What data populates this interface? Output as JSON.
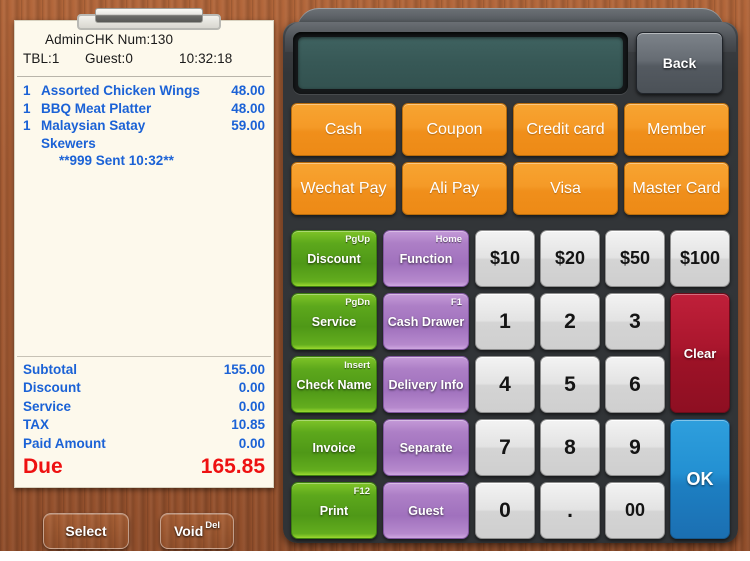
{
  "receipt": {
    "header": {
      "user": "Admin",
      "check_label": "CHK Num:130",
      "table_label": "TBL:1",
      "guest_label": "Guest:0",
      "time": "10:32:18"
    },
    "items": [
      {
        "qty": "1",
        "name": "Assorted Chicken Wings",
        "amount": "48.00"
      },
      {
        "qty": "1",
        "name": "BBQ Meat Platter",
        "amount": "48.00"
      },
      {
        "qty": "1",
        "name": "Malaysian Satay Skewers",
        "amount": "59.00"
      }
    ],
    "note": "**999 Sent 10:32**",
    "totals": [
      {
        "label": "Subtotal",
        "value": "155.00"
      },
      {
        "label": "Discount",
        "value": "0.00"
      },
      {
        "label": "Service",
        "value": "0.00"
      },
      {
        "label": "TAX",
        "value": "10.85"
      },
      {
        "label": "Paid Amount",
        "value": "0.00"
      }
    ],
    "due": {
      "label": "Due",
      "value": "165.85"
    }
  },
  "left_buttons": {
    "select": "Select",
    "void": "Void",
    "void_shortcut": "Del"
  },
  "panel": {
    "display_value": "",
    "back_label": "Back",
    "payment_buttons": [
      "Cash",
      "Coupon",
      "Credit card",
      "Member",
      "Wechat Pay",
      "Ali Pay",
      "Visa",
      "Master Card"
    ],
    "function_buttons": [
      {
        "label": "Discount",
        "shortcut": "PgUp",
        "color": "green"
      },
      {
        "label": "Function",
        "shortcut": "Home",
        "color": "purple"
      },
      {
        "label": "Service",
        "shortcut": "PgDn",
        "color": "green"
      },
      {
        "label": "Cash Drawer",
        "shortcut": "F1",
        "color": "purple"
      },
      {
        "label": "Check Name",
        "shortcut": "Insert",
        "color": "green"
      },
      {
        "label": "Delivery Info",
        "shortcut": "",
        "color": "purple"
      },
      {
        "label": "Invoice",
        "shortcut": "",
        "color": "green"
      },
      {
        "label": "Separate",
        "shortcut": "",
        "color": "purple"
      },
      {
        "label": "Print",
        "shortcut": "F12",
        "color": "green"
      },
      {
        "label": "Guest",
        "shortcut": "",
        "color": "purple"
      }
    ],
    "quick_cash": [
      "$10",
      "$20",
      "$50",
      "$100"
    ],
    "digits_row1": [
      "1",
      "2",
      "3"
    ],
    "digits_row2": [
      "4",
      "5",
      "6"
    ],
    "digits_row3": [
      "7",
      "8",
      "9"
    ],
    "digits_row4": [
      "0",
      ".",
      "00"
    ],
    "clear_label": "Clear",
    "ok_label": "OK"
  },
  "colors": {
    "wood": "#a05a32",
    "paper": "#fdf9ec",
    "item_blue": "#1b62d6",
    "due_red": "#ee1111",
    "orange": "#f59a27",
    "green": "#5da81c",
    "purple": "#ad7fc6",
    "clear_red": "#aa162d",
    "ok_blue": "#2390d2",
    "lcd": "#375856",
    "panel_dark": "#333639"
  }
}
